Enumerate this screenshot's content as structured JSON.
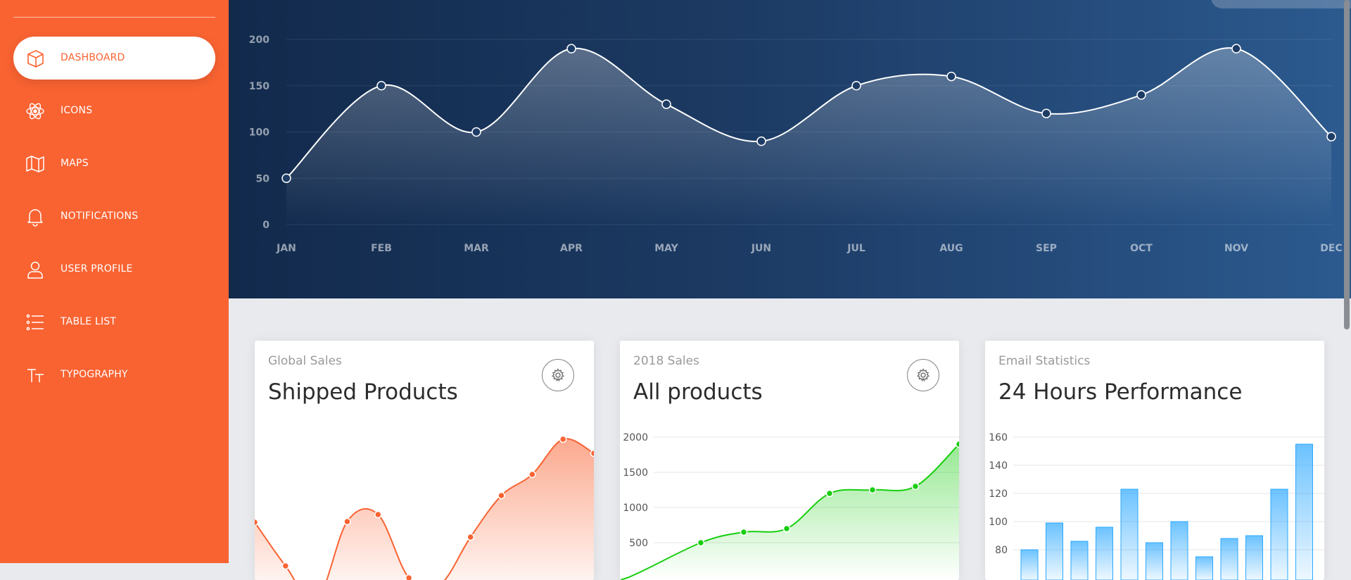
{
  "sidebar": {
    "items": [
      {
        "label": "DASHBOARD",
        "icon": "box-icon",
        "active": true
      },
      {
        "label": "ICONS",
        "icon": "atom-icon",
        "active": false
      },
      {
        "label": "MAPS",
        "icon": "map-icon",
        "active": false
      },
      {
        "label": "NOTIFICATIONS",
        "icon": "bell-icon",
        "active": false
      },
      {
        "label": "USER PROFILE",
        "icon": "user-icon",
        "active": false
      },
      {
        "label": "TABLE LIST",
        "icon": "list-icon",
        "active": false
      },
      {
        "label": "TYPOGRAPHY",
        "icon": "typography-icon",
        "active": false
      }
    ]
  },
  "colors": {
    "sidebar": "#f96332",
    "orange": "#f96332",
    "green": "#18ce0f",
    "blue": "#2ca8ff",
    "hero_start": "#122a4c",
    "hero_end": "#2c5a8f"
  },
  "chart_data": [
    {
      "type": "line",
      "categories": [
        "JAN",
        "FEB",
        "MAR",
        "APR",
        "MAY",
        "JUN",
        "JUL",
        "AUG",
        "SEP",
        "OCT",
        "NOV",
        "DEC"
      ],
      "values": [
        50,
        150,
        100,
        190,
        130,
        90,
        150,
        160,
        120,
        140,
        190,
        95
      ],
      "yticks": [
        0,
        50,
        100,
        150,
        200
      ],
      "ylim": [
        0,
        200
      ],
      "grid": true,
      "fill": "area"
    },
    {
      "type": "line",
      "category": "Global Sales",
      "title": "Shipped Products",
      "values": [
        542,
        480,
        430,
        543,
        553,
        463,
        453,
        521,
        580,
        610,
        660,
        640
      ],
      "grid": false,
      "color": "#f96332"
    },
    {
      "type": "line",
      "category": "2018 Sales",
      "title": "All products",
      "values": [
        0,
        0,
        0,
        0,
        500,
        650,
        700,
        1200,
        1250,
        1300,
        1900
      ],
      "yticks": [
        500,
        1000,
        1500,
        2000
      ],
      "ylim": [
        0,
        2000
      ],
      "grid": true,
      "color": "#18ce0f"
    },
    {
      "type": "bar",
      "category": "Email Statistics",
      "title": "24 Hours Performance",
      "values": [
        80,
        99,
        86,
        96,
        123,
        85,
        100,
        75,
        88,
        90,
        123,
        155
      ],
      "yticks": [
        80,
        100,
        120,
        140,
        160
      ],
      "ylim": [
        80,
        160
      ],
      "grid": true,
      "color": "#2ca8ff"
    }
  ]
}
